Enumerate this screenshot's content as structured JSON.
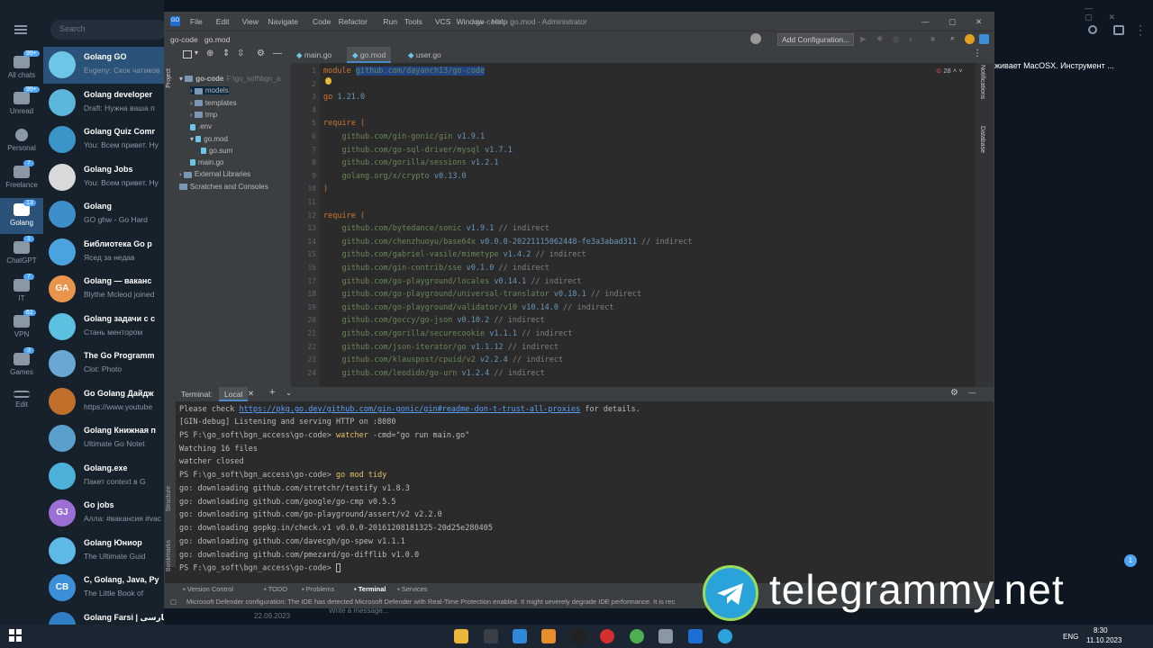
{
  "telegram": {
    "search_placeholder": "Search",
    "folders": [
      {
        "label": "All chats",
        "badge": "99+"
      },
      {
        "label": "Unread",
        "badge": "99+"
      },
      {
        "label": "Personal",
        "badge": ""
      },
      {
        "label": "Freelance",
        "badge": "7"
      },
      {
        "label": "Golang",
        "badge": "13"
      },
      {
        "label": "ChatGPT",
        "badge": "1"
      },
      {
        "label": "IT",
        "badge": "7"
      },
      {
        "label": "VPN",
        "badge": "61"
      },
      {
        "label": "Games",
        "badge": "3"
      },
      {
        "label": "Edit",
        "badge": ""
      }
    ],
    "chats": [
      {
        "name": "Golang GO",
        "preview": "Evgeny: Скок чатиков",
        "avatar": ""
      },
      {
        "name": "Golang developer",
        "preview": "Draft: Нужна ваша п",
        "avatar": ""
      },
      {
        "name": "Golang Quiz Comr",
        "preview": "You: Всем привет. Ну",
        "avatar": ""
      },
      {
        "name": "Golang Jobs",
        "preview": "You: Всем привет. Ну",
        "avatar": ""
      },
      {
        "name": "Golang",
        "preview": "GO ghw - Go Hard",
        "avatar": ""
      },
      {
        "name": "Библиотека Go p",
        "preview": "Ясед за недав",
        "avatar": ""
      },
      {
        "name": "Golang — ваканс",
        "preview": "Blythe Mcleod joined",
        "avatar": "GA"
      },
      {
        "name": "Golang задачи с c",
        "preview": "Стань ментором",
        "avatar": ""
      },
      {
        "name": "The Go Programm",
        "preview": "Clot: Photo",
        "avatar": ""
      },
      {
        "name": "Go Golang Дайдж",
        "preview": "https://www.youtube",
        "avatar": ""
      },
      {
        "name": "Golang Книжная п",
        "preview": "Ultimate Go Notet",
        "avatar": ""
      },
      {
        "name": "Golang.exe",
        "preview": "Пакет context в G",
        "avatar": ""
      },
      {
        "name": "Go jobs",
        "preview": "Алла: #вакансия #vac",
        "avatar": "GJ"
      },
      {
        "name": "Golang Юниор",
        "preview": "The Ultimate Guid",
        "avatar": ""
      },
      {
        "name": "C, Golang, Java, Py",
        "preview": "The Little Book of",
        "avatar": "CB"
      },
      {
        "name": "Golang Farsi | گولنگ فارسی",
        "preview": "",
        "avatar": ""
      }
    ],
    "right_preview": "живает MacOSX. Инструмент ...",
    "date_label": "22.09.2023",
    "message_placeholder": "Write a message...",
    "unread_badge": "1"
  },
  "ide": {
    "menu": [
      "File",
      "Edit",
      "View",
      "Navigate",
      "Code",
      "Refactor",
      "Run",
      "Tools",
      "VCS",
      "Window",
      "Help"
    ],
    "window_title": "go-code - go.mod - Administrator",
    "breadcrumb": [
      "go-code",
      "go.mod"
    ],
    "add_config": "Add Configuration...",
    "tabs": [
      "main.go",
      "go.mod",
      "user.go"
    ],
    "project_label": "Project",
    "notifications_label": "Notifications",
    "database_label": "Database",
    "structure_label": "Structure",
    "bookmarks_label": "Bookmarks",
    "warnings": "28",
    "tree": [
      {
        "label": "go-code",
        "note": "F:\\go_soft\\bgn_a"
      },
      {
        "label": "models",
        "note": ""
      },
      {
        "label": "templates",
        "note": ""
      },
      {
        "label": "tmp",
        "note": ""
      },
      {
        "label": ".env",
        "note": ""
      },
      {
        "label": "go.mod",
        "note": ""
      },
      {
        "label": "go.sum",
        "note": ""
      },
      {
        "label": "main.go",
        "note": ""
      },
      {
        "label": "External Libraries",
        "note": ""
      },
      {
        "label": "Scratches and Consoles",
        "note": ""
      }
    ],
    "code": {
      "module_kw": "module",
      "module_path": "github.com/dayanch13/go-code",
      "go_kw": "go",
      "go_ver": "1.21.0",
      "require_kw": "require (",
      "req1": [
        {
          "p": "github.com/gin-gonic/gin",
          "v": "v1.9.1"
        },
        {
          "p": "github.com/go-sql-driver/mysql",
          "v": "v1.7.1"
        },
        {
          "p": "github.com/gorilla/sessions",
          "v": "v1.2.1"
        },
        {
          "p": "golang.org/x/crypto",
          "v": "v0.13.0"
        }
      ],
      "close": ")",
      "req2": [
        {
          "p": "github.com/bytedance/sonic",
          "v": "v1.9.1"
        },
        {
          "p": "github.com/chenzhuoyu/base64x",
          "v": "v0.0.0-20221115062448-fe3a3abad311"
        },
        {
          "p": "github.com/gabriel-vasile/mimetype",
          "v": "v1.4.2"
        },
        {
          "p": "github.com/gin-contrib/sse",
          "v": "v0.1.0"
        },
        {
          "p": "github.com/go-playground/locales",
          "v": "v0.14.1"
        },
        {
          "p": "github.com/go-playground/universal-translator",
          "v": "v0.18.1"
        },
        {
          "p": "github.com/go-playground/validator/v10",
          "v": "v10.14.0"
        },
        {
          "p": "github.com/goccy/go-json",
          "v": "v0.10.2"
        },
        {
          "p": "github.com/gorilla/securecookie",
          "v": "v1.1.1"
        },
        {
          "p": "github.com/json-iterator/go",
          "v": "v1.1.12"
        },
        {
          "p": "github.com/klauspost/cpuid/v2",
          "v": "v2.2.4"
        },
        {
          "p": "github.com/leodido/go-urn",
          "v": "v1.2.4"
        }
      ],
      "indirect": "// indirect",
      "line_numbers": [
        "1",
        "2",
        "3",
        "4",
        "5",
        "6",
        "7",
        "8",
        "9",
        "10",
        "11",
        "12",
        "13",
        "14",
        "15",
        "16",
        "17",
        "18",
        "19",
        "20",
        "21",
        "22",
        "23",
        "24"
      ]
    },
    "terminal": {
      "title": "Terminal:",
      "tab": "Local",
      "line1_pre": "Please check ",
      "line1_link": "https://pkg.go.dev/github.com/gin-gonic/gin#readme-don-t-trust-all-proxies",
      "line1_post": " for details.",
      "line2": "[GIN-debug] Listening and serving HTTP on :8080",
      "line3_pre": "PS F:\\go_soft\\bgn_access\\go-code> ",
      "line3_cmd": "watcher",
      "line3_post": " -cmd=\"go run main.go\"",
      "line4": "Watching 16 files",
      "line5": "watcher closed",
      "line6_pre": "PS F:\\go_soft\\bgn_access\\go-code> ",
      "line6_cmd": "go mod tidy",
      "dl": [
        "go: downloading github.com/stretchr/testify v1.8.3",
        "go: downloading github.com/google/go-cmp v0.5.5",
        "go: downloading github.com/go-playground/assert/v2 v2.2.0",
        "go: downloading gopkg.in/check.v1 v0.0.0-20161208181325-20d25e280405",
        "go: downloading github.com/davecgh/go-spew v1.1.1",
        "go: downloading github.com/pmezard/go-difflib v1.0.0"
      ],
      "prompt": "PS F:\\go_soft\\bgn_access\\go-code> "
    },
    "bottom_tabs": [
      "Version Control",
      "TODO",
      "Problems",
      "Terminal",
      "Services"
    ],
    "status": "Microsoft Defender configuration: The IDE has detected Microsoft Defender with Real-Time Protection enabled. It might severely degrade IDE performance. It is rec"
  },
  "taskbar": {
    "lang": "ENG",
    "time": "8:30",
    "date": "11.10.2023"
  },
  "watermark": "telegrammy.net"
}
